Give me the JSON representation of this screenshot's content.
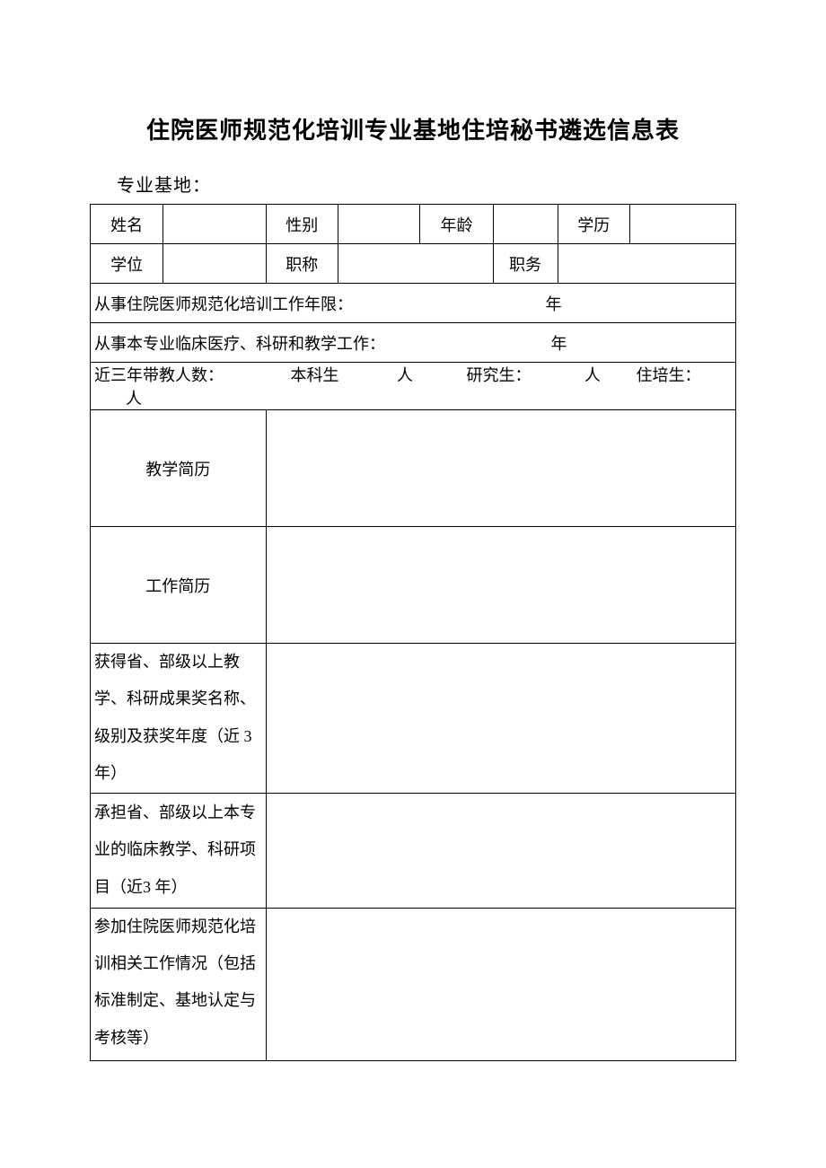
{
  "title": "住院医师规范化培训专业基地住培秘书遴选信息表",
  "subtitle": "专业基地：",
  "labels": {
    "name": "姓名",
    "gender": "性别",
    "age": "年龄",
    "education": "学历",
    "degree": "学位",
    "protitle": "职称",
    "position": "职务",
    "trainYears": "从事住院医师规范化培训工作年限：",
    "clinicalYears": "从事本专业临床医疗、科研和教学工作：",
    "yearUnit": "年",
    "teachCount": "近三年带教人数：",
    "undergrad": "本科生",
    "grad": "研究生：",
    "trainee": "住培生：",
    "personUnit": "人",
    "teachResume": "教学简历",
    "workResume": "工作简历",
    "awards": "获得省、部级以上教学、科研成果奖名称、级别及获奖年度（近 3 年）",
    "projects": "承担省、部级以上本专业的临床教学、科研项目（近3 年）",
    "participation": "参加住院医师规范化培训相关工作情况（包括标准制定、基地认定与考核等）"
  },
  "values": {
    "name": "",
    "gender": "",
    "age": "",
    "education": "",
    "degree": "",
    "protitle": "",
    "position": "",
    "trainYears": "",
    "clinicalYears": "",
    "undergradCount": "",
    "gradCount": "",
    "traineeCount": "",
    "teachResume": "",
    "workResume": "",
    "awards": "",
    "projects": "",
    "participation": ""
  }
}
